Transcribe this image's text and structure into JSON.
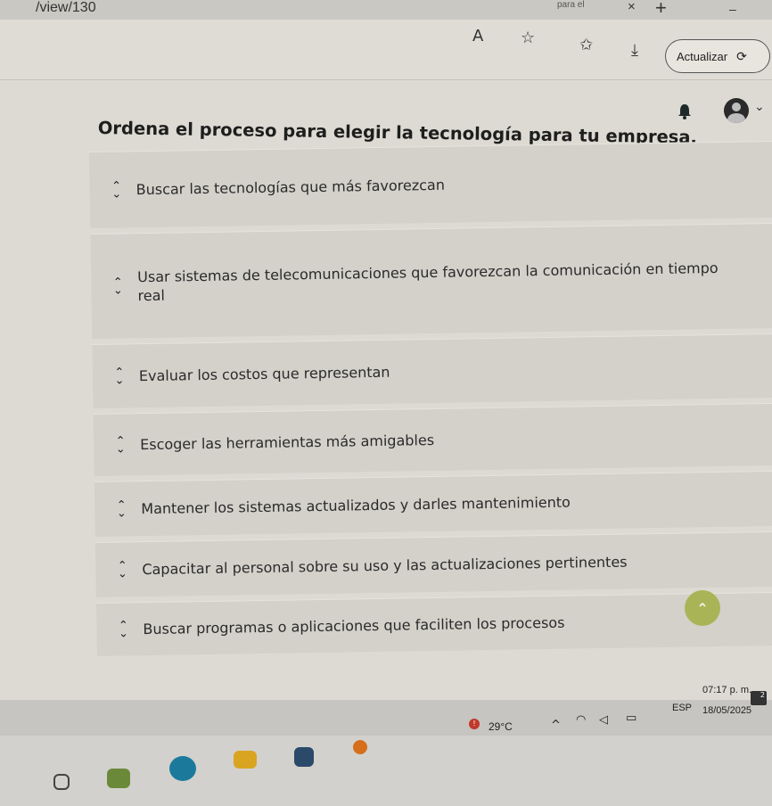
{
  "browser": {
    "tab_url": "/view/130",
    "tab_title": "para el",
    "tab_close": "×",
    "new_tab": "+",
    "minimize": "–",
    "update_label": "Actualizar"
  },
  "question": {
    "text": "Ordena el proceso para elegir la tecnología para tu empresa."
  },
  "items": [
    {
      "text": "Buscar las tecnologías que más favorezcan"
    },
    {
      "text": "Usar sistemas de telecomunicaciones que favorezcan la comunicación en tiempo real"
    },
    {
      "text": "Evaluar los costos que representan"
    },
    {
      "text": "Escoger las herramientas más amigables"
    },
    {
      "text": "Mantener los sistemas actualizados y darles mantenimiento"
    },
    {
      "text": "Capacitar al personal sobre su uso y las actualizaciones pertinentes"
    },
    {
      "text": "Buscar programas o aplicaciones que faciliten los procesos"
    }
  ],
  "taskbar": {
    "temperature": "29°C",
    "language": "ESP",
    "time": "07:17 p. m.",
    "date": "18/05/2025",
    "notification_count": "2"
  },
  "icons": {
    "read_aloud": "A",
    "favorite": "☆",
    "favorites": "✩",
    "download": "⤓",
    "bell": "🔔",
    "chevron": "⌄",
    "scroll_top": "⌃",
    "tray_up": "^"
  },
  "colors": {
    "scroll_top_button": "#a9b457",
    "item_background": "#d3d1ca"
  }
}
